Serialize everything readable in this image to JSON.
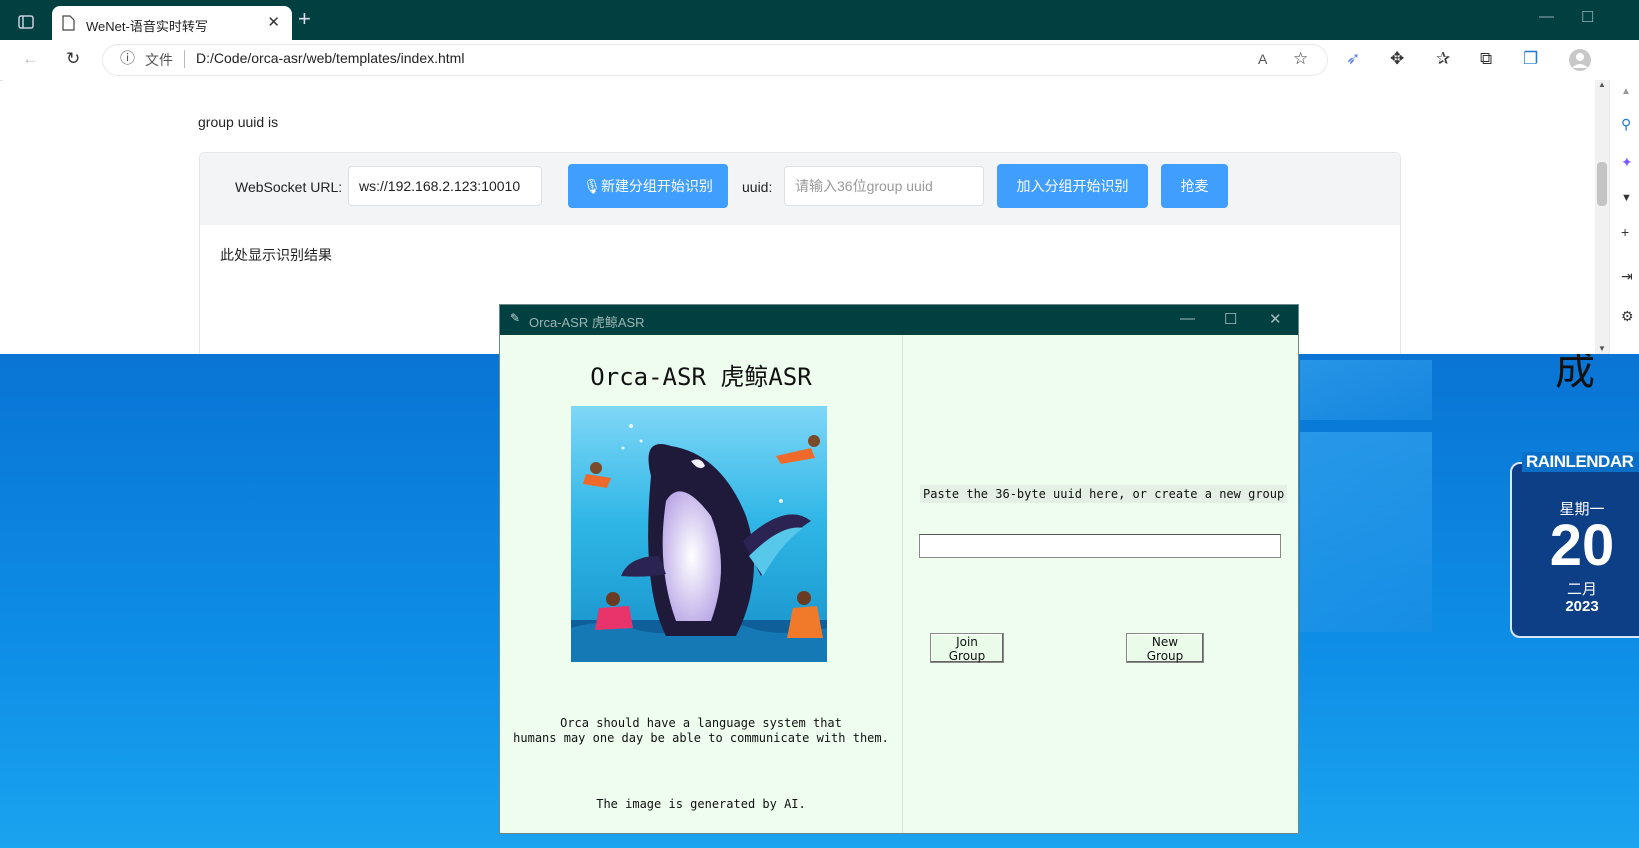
{
  "desktop": {
    "widget_title": "RAINLENDAR",
    "weekday": "星期一",
    "day": "20",
    "month": "二月",
    "year": "2023",
    "glyph": "成"
  },
  "browser": {
    "tab_title": "WeNet-语音实时转写",
    "address_info": "文件",
    "address_url": "D:/Code/orca-asr/web/templates/index.html"
  },
  "page": {
    "group_label": "group uuid is",
    "ws_label": "WebSocket URL:",
    "ws_value": "ws://192.168.2.123:10010",
    "new_group_button": "新建分组开始识别",
    "uuid_label": "uuid:",
    "uuid_placeholder": "请输入36位group uuid",
    "join_button": "加入分组开始识别",
    "grab_mic_button": "抢麦",
    "result_text": "此处显示识别结果"
  },
  "app": {
    "window_title": "Orca-ASR 虎鲸ASR",
    "heading": "Orca-ASR 虎鲸ASR",
    "tagline_line1": "Orca should have a language system that",
    "tagline_line2": "humans may one day be able to communicate with them.",
    "credit": "The image is generated by AI.",
    "hint": "Paste the 36-byte uuid here, or create a new group",
    "uuid_value": "",
    "join_button": "Join Group",
    "new_button": "New Group"
  },
  "colors": {
    "titlebar": "#004040",
    "primary_button": "#409eff",
    "app_background": "#eefdee"
  }
}
